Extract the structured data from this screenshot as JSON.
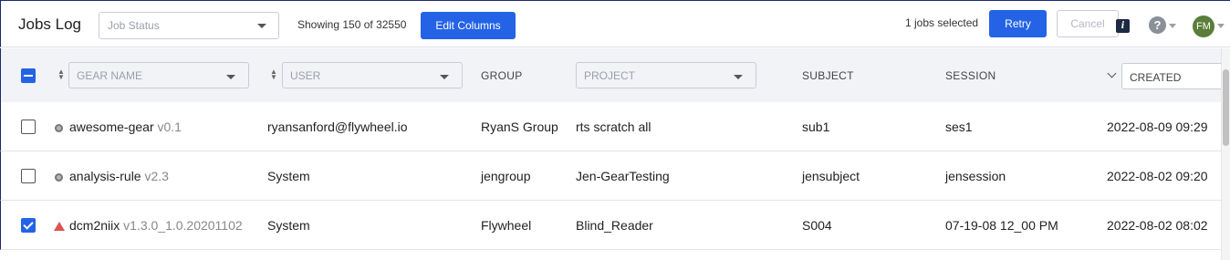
{
  "page": {
    "title": "Jobs Log"
  },
  "toolbar": {
    "job_status_placeholder": "Job Status",
    "showing": "Showing 150 of 32550",
    "edit_columns": "Edit Columns",
    "selected_count": "1 jobs selected",
    "retry": "Retry",
    "cancel": "Cancel",
    "info_glyph": "i",
    "help_glyph": "?",
    "avatar_initials": "FM"
  },
  "columns": {
    "gear_name": "GEAR NAME",
    "user": "USER",
    "group": "GROUP",
    "project": "PROJECT",
    "subject": "SUBJECT",
    "session": "SESSION",
    "created": "CREATED"
  },
  "rows": [
    {
      "checked": false,
      "status_icon": "gray-dot-icon",
      "gear": "awesome-gear",
      "version": "v0.1",
      "user": "ryansanford@flywheel.io",
      "group": "RyanS Group",
      "project": "rts scratch all",
      "subject": "sub1",
      "session": "ses1",
      "created": "2022-08-09 09:29"
    },
    {
      "checked": false,
      "status_icon": "gray-dot-icon",
      "gear": "analysis-rule",
      "version": "v2.3",
      "user": "System",
      "group": "jengroup",
      "project": "Jen-GearTesting",
      "subject": "jensubject",
      "session": "jensession",
      "created": "2022-08-02 09:20"
    },
    {
      "checked": true,
      "status_icon": "warning-triangle-icon",
      "gear": "dcm2niix",
      "version": "v1.3.0_1.0.20201102",
      "user": "System",
      "group": "Flywheel",
      "project": "Blind_Reader",
      "subject": "S004",
      "session": "07-19-08 12_00 PM",
      "created": "2022-08-02 08:02"
    }
  ],
  "colors": {
    "accent": "#2463e6",
    "warning": "#e0524f",
    "avatar_bg": "#5a7d3a"
  }
}
